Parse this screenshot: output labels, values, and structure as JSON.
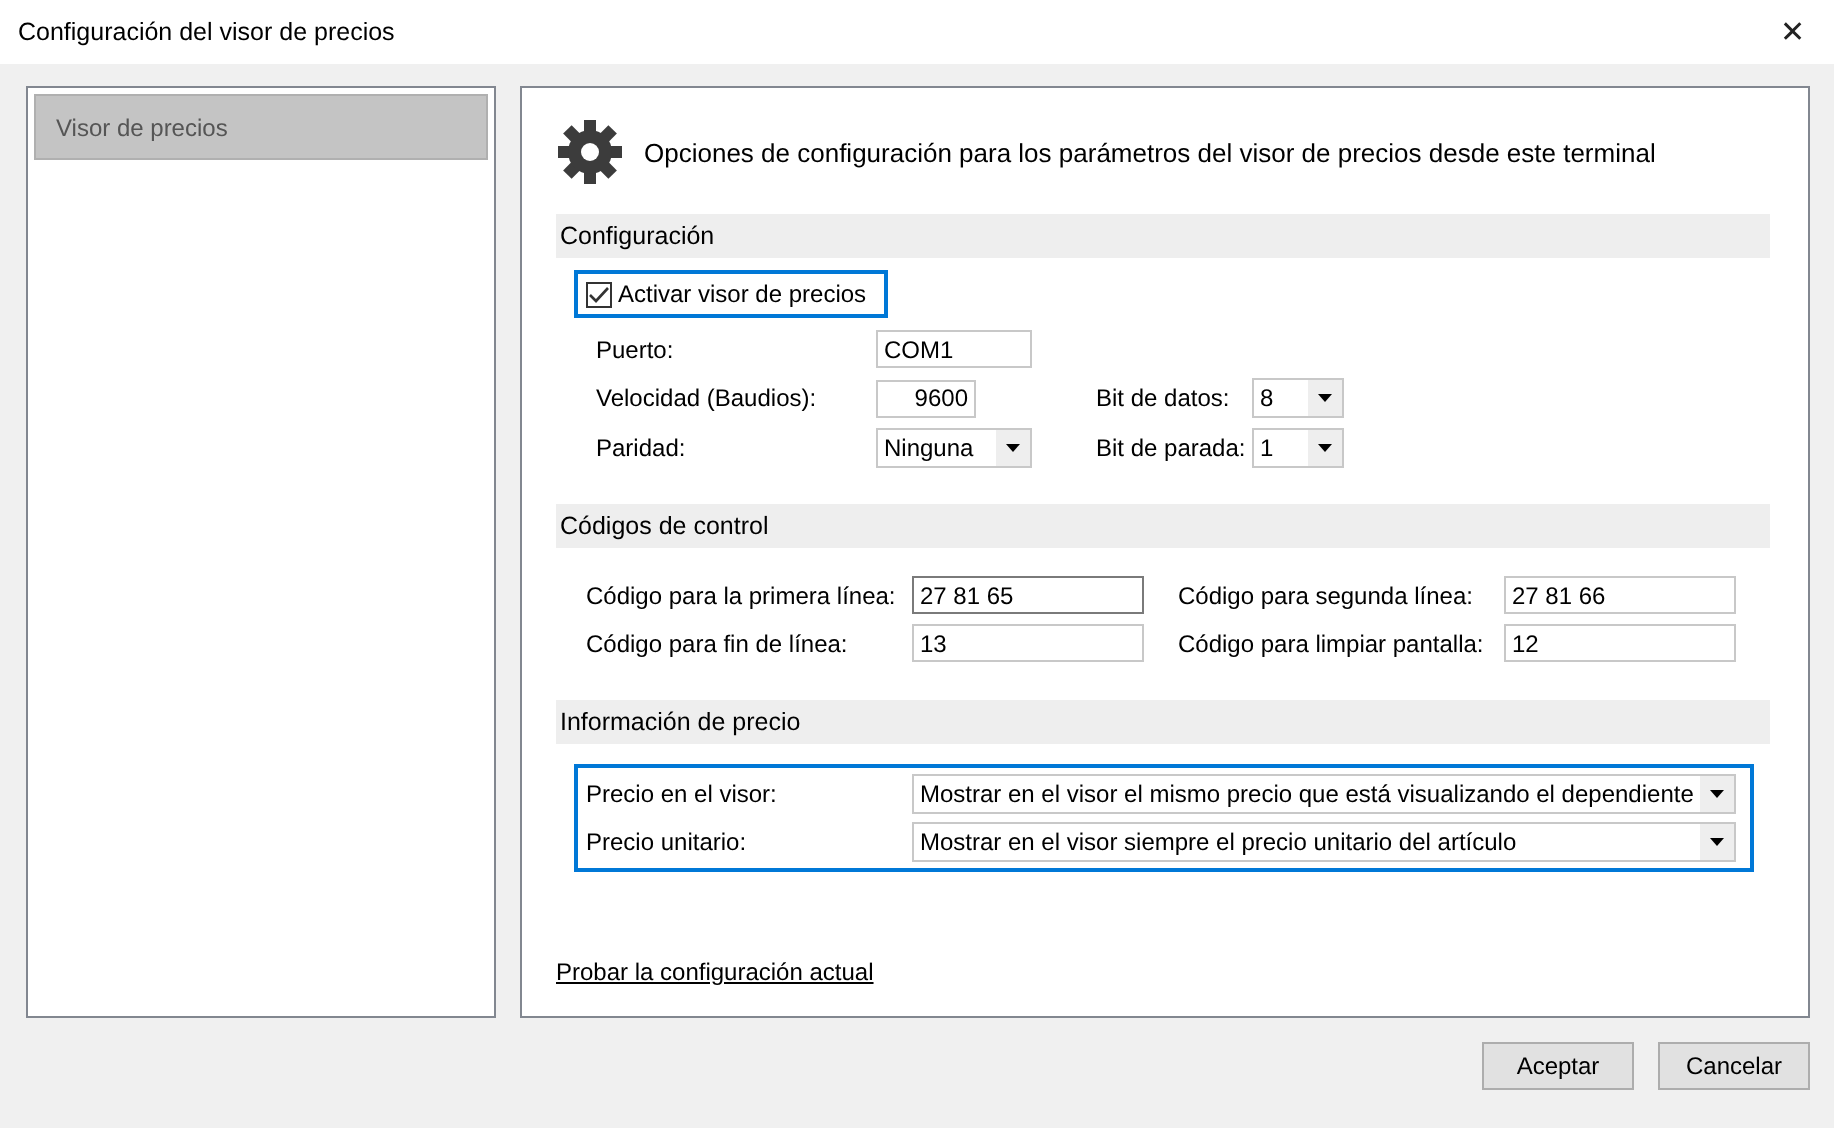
{
  "window": {
    "title": "Configuración del visor de precios",
    "close": "✕"
  },
  "sidebar": {
    "items": [
      {
        "label": "Visor de precios",
        "selected": true
      }
    ]
  },
  "header": "Opciones de configuración para los parámetros del visor de precios desde este terminal",
  "configuracion": {
    "title": "Configuración",
    "enable": {
      "label": "Activar visor de precios",
      "checked": true,
      "focused": true
    },
    "puerto": {
      "label": "Puerto:",
      "value": "COM1"
    },
    "velocidad": {
      "label": "Velocidad (Baudios):",
      "value": "9600"
    },
    "bit_datos": {
      "label": "Bit de datos:",
      "value": "8"
    },
    "paridad": {
      "label": "Paridad:",
      "value": "Ninguna"
    },
    "bit_parada": {
      "label": "Bit de parada:",
      "value": "1"
    }
  },
  "codigos": {
    "title": "Códigos de control",
    "fields": [
      {
        "label": "Código para la primera línea:",
        "value": "27 81 65",
        "focused": true
      },
      {
        "label": "Código para segunda línea:",
        "value": "27 81 66",
        "focused": false
      },
      {
        "label": "Código para fin de línea:",
        "value": "13",
        "focused": false
      },
      {
        "label": "Código para limpiar pantalla:",
        "value": "12",
        "focused": false
      }
    ]
  },
  "precio": {
    "title": "Información de precio",
    "focused": true,
    "fields": [
      {
        "label": "Precio en el visor:",
        "value": "Mostrar en el visor el mismo precio que está visualizando el dependiente"
      },
      {
        "label": "Precio unitario:",
        "value": "Mostrar en el visor siempre el precio unitario del artículo"
      }
    ]
  },
  "link": "Probar la configuración actual",
  "buttons": [
    "Aceptar",
    "Cancelar"
  ]
}
